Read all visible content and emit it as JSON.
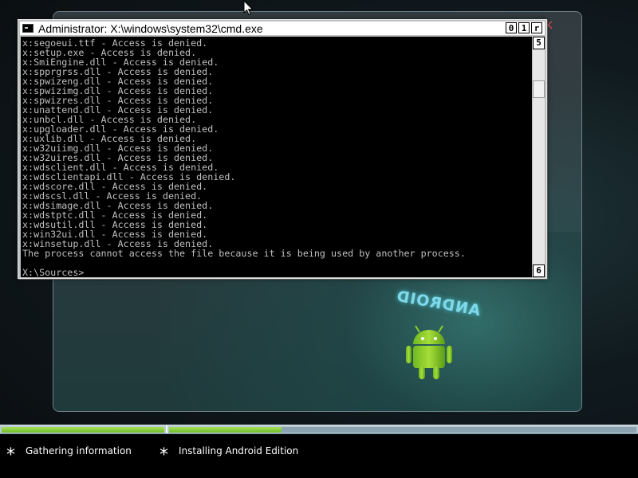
{
  "window": {
    "title": "Administrator: X:\\windows\\system32\\cmd.exe",
    "buttons": {
      "minimize": "0",
      "maximize": "1",
      "close": "r"
    },
    "scroll_up": "5",
    "scroll_down": "6"
  },
  "console": {
    "lines": [
      "x:segoeui.ttf - Access is denied.",
      "x:setup.exe - Access is denied.",
      "x:SmiEngine.dll - Access is denied.",
      "x:spprgrss.dll - Access is denied.",
      "x:spwizeng.dll - Access is denied.",
      "x:spwizimg.dll - Access is denied.",
      "x:spwizres.dll - Access is denied.",
      "x:unattend.dll - Access is denied.",
      "x:unbcl.dll - Access is denied.",
      "x:upgloader.dll - Access is denied.",
      "x:uxlib.dll - Access is denied.",
      "x:w32uiimg.dll - Access is denied.",
      "x:w32uires.dll - Access is denied.",
      "x:wdsclient.dll - Access is denied.",
      "x:wdsclientapi.dll - Access is denied.",
      "x:wdscore.dll - Access is denied.",
      "x:wdscsl.dll - Access is denied.",
      "x:wdsimage.dll - Access is denied.",
      "x:wdstptc.dll - Access is denied.",
      "x:wdsutil.dll - Access is denied.",
      "x:win32ui.dll - Access is denied.",
      "x:winsetup.dll - Access is denied.",
      "The process cannot access the file because it is being used by another process."
    ],
    "prompt": "X:\\Sources>"
  },
  "background": {
    "logo_text": "ANDROID",
    "close_glyph": "×"
  },
  "progress": {
    "step1_fraction": 1.0,
    "step2_fraction": 0.24
  },
  "steps": [
    {
      "icon": "*",
      "label": "Gathering information"
    },
    {
      "icon": "*",
      "label": "Installing Android Edition"
    }
  ],
  "colors": {
    "console_bg": "#000000",
    "console_text": "#c0c0c0",
    "progress_green": "#6dbd2a",
    "progress_track": "#8ca3b2",
    "close_red": "#d04a4a"
  }
}
